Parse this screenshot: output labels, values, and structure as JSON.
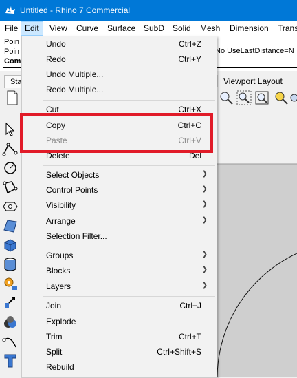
{
  "window": {
    "title": "Untitled - Rhino 7 Commercial"
  },
  "menubar": {
    "items": [
      {
        "label": "File"
      },
      {
        "label": "Edit"
      },
      {
        "label": "View"
      },
      {
        "label": "Curve"
      },
      {
        "label": "Surface"
      },
      {
        "label": "SubD"
      },
      {
        "label": "Solid"
      },
      {
        "label": "Mesh"
      },
      {
        "label": "Dimension"
      },
      {
        "label": "Trans"
      }
    ],
    "active": "Edit"
  },
  "history": {
    "line1": "Poin",
    "line2": "Poin",
    "command_prompt": "Com",
    "right_text": "No  UseLastDistance=N"
  },
  "toolbar": {
    "left_tab": "Sta",
    "viewport_layout_tab": "Viewport Layout"
  },
  "edit_menu": {
    "items": [
      {
        "label": "Undo",
        "shortcut": "Ctrl+Z",
        "submenu": false,
        "disabled": false
      },
      {
        "label": "Redo",
        "shortcut": "Ctrl+Y",
        "submenu": false,
        "disabled": false
      },
      {
        "label": "Undo Multiple...",
        "shortcut": "",
        "submenu": false,
        "disabled": false
      },
      {
        "label": "Redo Multiple...",
        "shortcut": "",
        "submenu": false,
        "disabled": false
      },
      {
        "label": "Cut",
        "shortcut": "Ctrl+X",
        "submenu": false,
        "disabled": false
      },
      {
        "label": "Copy",
        "shortcut": "Ctrl+C",
        "submenu": false,
        "disabled": false
      },
      {
        "label": "Paste",
        "shortcut": "Ctrl+V",
        "submenu": false,
        "disabled": true
      },
      {
        "label": "Delete",
        "shortcut": "Del",
        "submenu": false,
        "disabled": false
      },
      {
        "label": "Select Objects",
        "shortcut": "",
        "submenu": true,
        "disabled": false
      },
      {
        "label": "Control Points",
        "shortcut": "",
        "submenu": true,
        "disabled": false
      },
      {
        "label": "Visibility",
        "shortcut": "",
        "submenu": true,
        "disabled": false
      },
      {
        "label": "Arrange",
        "shortcut": "",
        "submenu": true,
        "disabled": false
      },
      {
        "label": "Selection Filter...",
        "shortcut": "",
        "submenu": false,
        "disabled": false
      },
      {
        "label": "Groups",
        "shortcut": "",
        "submenu": true,
        "disabled": false
      },
      {
        "label": "Blocks",
        "shortcut": "",
        "submenu": true,
        "disabled": false
      },
      {
        "label": "Layers",
        "shortcut": "",
        "submenu": true,
        "disabled": false
      },
      {
        "label": "Join",
        "shortcut": "Ctrl+J",
        "submenu": false,
        "disabled": false
      },
      {
        "label": "Explode",
        "shortcut": "",
        "submenu": false,
        "disabled": false
      },
      {
        "label": "Trim",
        "shortcut": "Ctrl+T",
        "submenu": false,
        "disabled": false
      },
      {
        "label": "Split",
        "shortcut": "Ctrl+Shift+S",
        "submenu": false,
        "disabled": false
      },
      {
        "label": "Rebuild",
        "shortcut": "",
        "submenu": false,
        "disabled": false
      }
    ]
  },
  "colors": {
    "titlebar": "#0078d7",
    "menu_active": "#cce8ff",
    "highlight": "#e11b28",
    "disabled_text": "#8d8d8d"
  },
  "icons": {
    "app": "rhino-icon",
    "submenu": "chevron-right-icon"
  }
}
